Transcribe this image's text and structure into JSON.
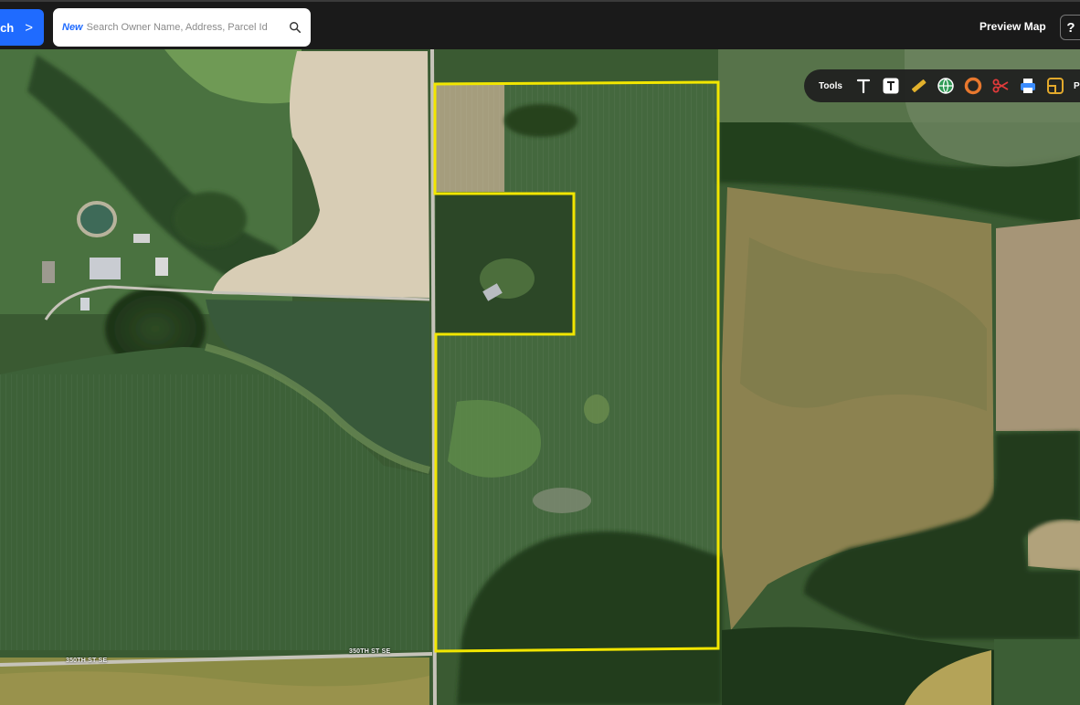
{
  "topbar": {
    "search_button_label": "ch",
    "search_button_chevron": ">",
    "new_tag": "New",
    "search_placeholder": "Search Owner Name, Address, Parcel Id",
    "preview_map_label": "Preview Map",
    "help_label": "?"
  },
  "tools": {
    "label": "Tools",
    "overflow_label": "P",
    "items": [
      {
        "icon": "text-icon"
      },
      {
        "icon": "text-box-icon"
      },
      {
        "icon": "ruler-icon"
      },
      {
        "icon": "globe-icon"
      },
      {
        "icon": "circle-icon"
      },
      {
        "icon": "scissors-icon"
      },
      {
        "icon": "printer-icon"
      },
      {
        "icon": "layout-icon"
      }
    ]
  },
  "map": {
    "road_labels": [
      "350TH ST SE",
      "350TH ST SE"
    ],
    "parcel_outline_color": "#f2e600"
  },
  "colors": {
    "accent": "#1f6bff",
    "topbar": "#1a1a1a"
  }
}
